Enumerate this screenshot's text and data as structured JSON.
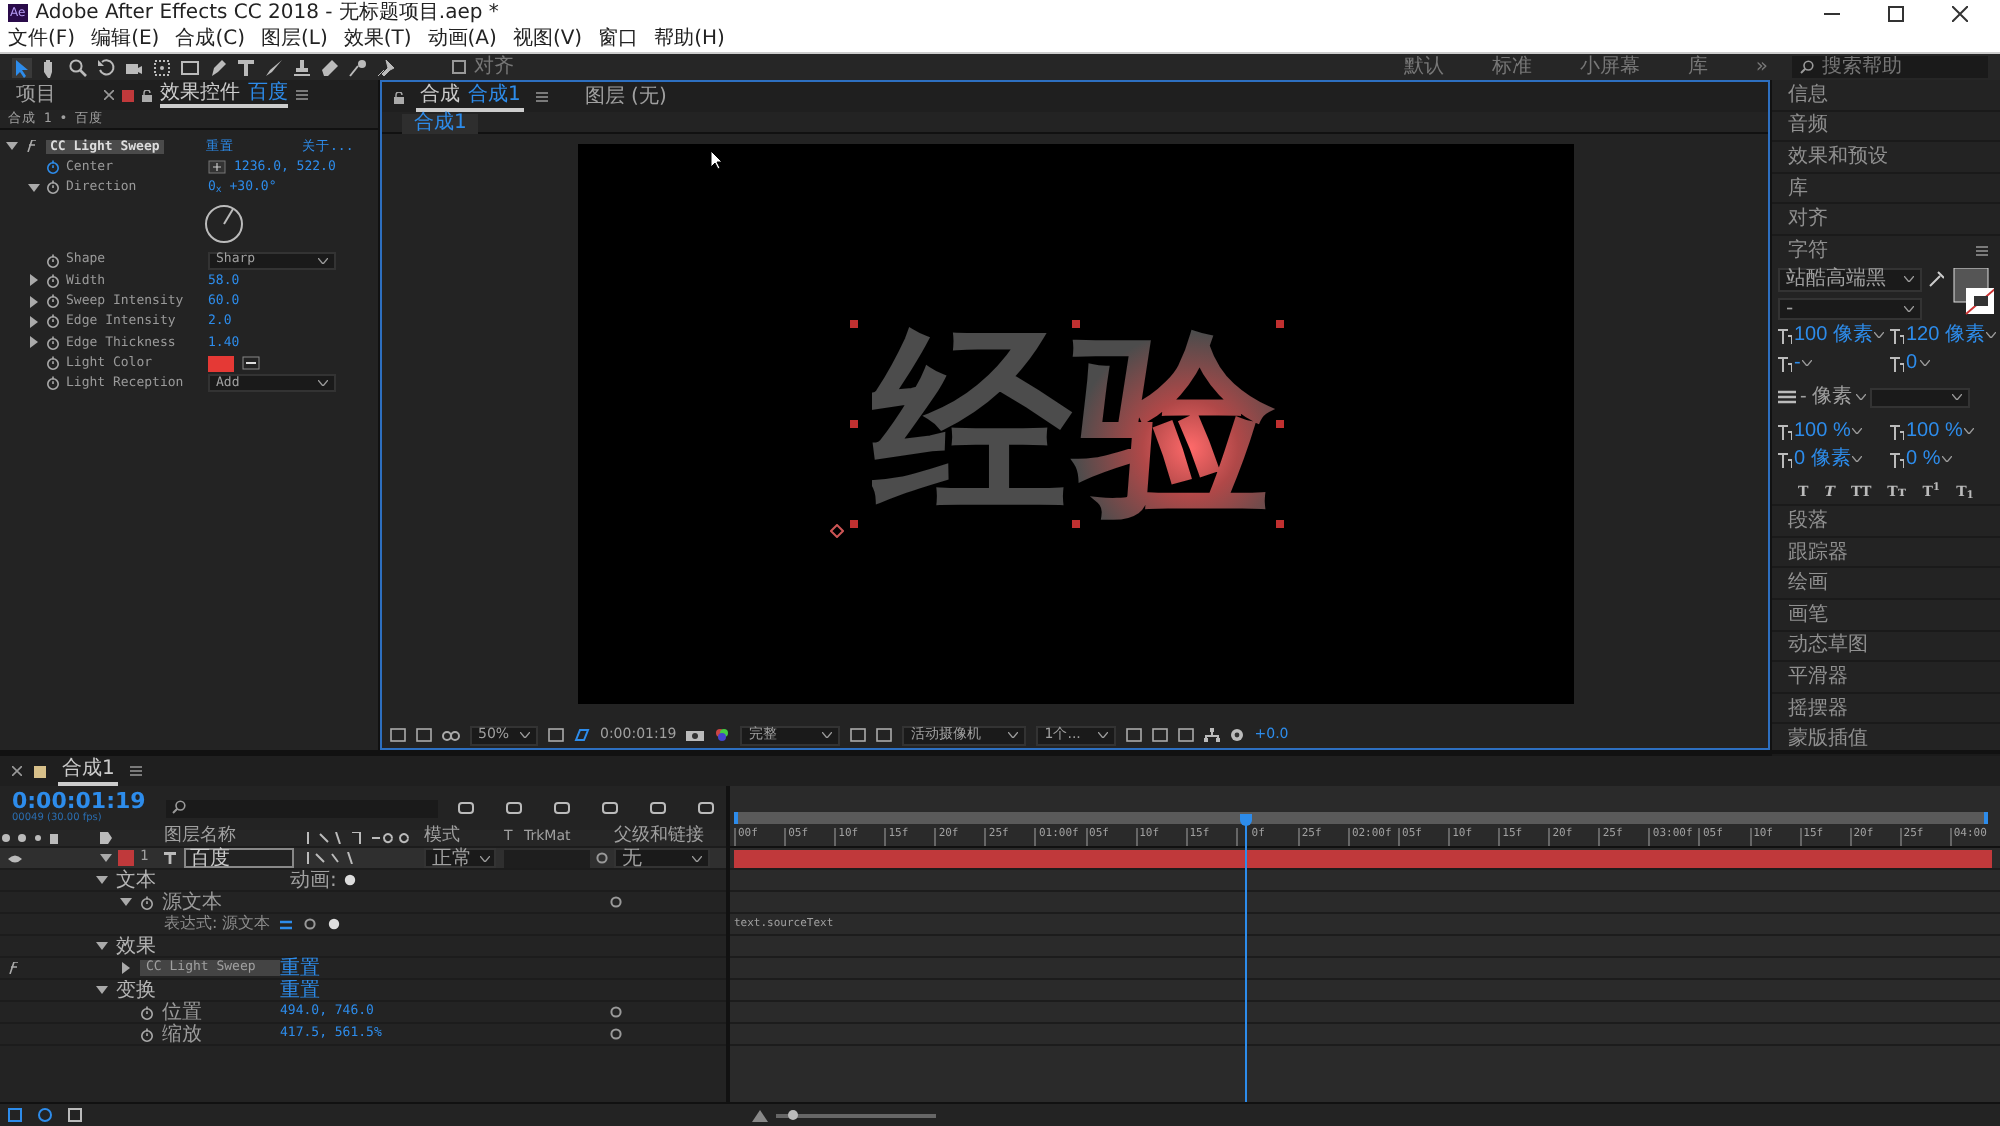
{
  "window": {
    "logo": "Ae",
    "title": "Adobe After Effects CC 2018 - 无标题项目.aep *"
  },
  "menu": [
    "文件(F)",
    "编辑(E)",
    "合成(C)",
    "图层(L)",
    "效果(T)",
    "动画(A)",
    "视图(V)",
    "窗口",
    "帮助(H)"
  ],
  "toolbar": {
    "tools": [
      {
        "kind": "select",
        "selected": true
      },
      {
        "kind": "hand",
        "selected": false
      },
      {
        "kind": "zoom",
        "selected": false
      },
      {
        "kind": "rotate",
        "selected": false
      },
      {
        "kind": "camera",
        "selected": false
      },
      {
        "kind": "pan",
        "selected": false
      },
      {
        "kind": "rect",
        "selected": false
      },
      {
        "kind": "pen",
        "selected": false
      },
      {
        "kind": "type",
        "selected": false
      },
      {
        "kind": "brush",
        "selected": false
      },
      {
        "kind": "stamp",
        "selected": false
      },
      {
        "kind": "eraser",
        "selected": false
      },
      {
        "kind": "roto",
        "selected": false
      },
      {
        "kind": "pin",
        "selected": false
      }
    ],
    "snap": {
      "label": "对齐",
      "checked": false
    },
    "workspaces": [
      "默认",
      "标准",
      "小屏幕",
      "库"
    ],
    "more": "»",
    "search": {
      "placeholder": "搜索帮助"
    }
  },
  "effect_panel": {
    "tabs": [
      {
        "label": "项目",
        "selected": false
      },
      {
        "label": "效果控件",
        "layer": "百度",
        "selected": true
      }
    ],
    "breadcrumb": "合成 1 • 百度",
    "effect": {
      "name": "CC Light Sweep",
      "reset": "重置",
      "about": "关于...",
      "expanded": true
    },
    "params": [
      {
        "kind": "point",
        "name": "Center",
        "value": "1236.0, 522.0"
      },
      {
        "kind": "angle",
        "name": "Direction",
        "value": "0$_{x}$ +30.0°",
        "expanded": true
      },
      {
        "kind": "dropdown",
        "name": "Shape",
        "value": "Sharp"
      },
      {
        "kind": "number",
        "name": "Width",
        "value": "58.0",
        "expanded": false
      },
      {
        "kind": "number",
        "name": "Sweep Intensity",
        "value": "60.0",
        "expanded": false
      },
      {
        "kind": "number",
        "name": "Edge Intensity",
        "value": "2.0",
        "expanded": false
      },
      {
        "kind": "number",
        "name": "Edge Thickness",
        "value": "1.40",
        "expanded": false
      },
      {
        "kind": "color",
        "name": "Light Color",
        "color": "#e53935"
      },
      {
        "kind": "dropdown",
        "name": "Light Reception",
        "value": "Add"
      }
    ]
  },
  "viewer": {
    "tabs": [
      {
        "label": "合成",
        "comp": "合成1",
        "selected": true
      },
      {
        "label": "图层 (无)",
        "selected": false
      }
    ],
    "sub_tab": "合成1",
    "comp_text": "经验",
    "toolbar": {
      "zoom": "50%",
      "time": "0:00:01:19",
      "resolution": "完整",
      "camera": "活动摄像机",
      "views": "1个...",
      "exposure": "+0.0"
    }
  },
  "side_panels_top": [
    "信息",
    "音频",
    "效果和预设",
    "库",
    "对齐"
  ],
  "character": {
    "title": "字符",
    "font": "站酷高端黑",
    "style": "-",
    "size": "100 像素",
    "leading": "120 像素",
    "kerning": "-",
    "tracking": "0",
    "stroke": "- 像素",
    "vscale": "100 %",
    "hscale": "100 %",
    "baseline": "0 像素",
    "tsume": "0 %",
    "styles": [
      "T",
      "T",
      "TT",
      "Tт",
      "T$^{1}$",
      "T$_{1}$"
    ]
  },
  "side_panels_bottom": [
    "段落",
    "跟踪器",
    "绘画",
    "画笔",
    "动态草图",
    "平滑器",
    "摇摆器",
    "蒙版插值"
  ],
  "timeline": {
    "tab": "合成1",
    "time": "0:00:01:19",
    "frames": "00049 (30.00 fps)",
    "columns": {
      "name": "图层名称",
      "mode": "模式",
      "t": "T",
      "trkmat": "TrkMat",
      "parent": "父级和链接"
    },
    "layers": [
      {
        "number": "1",
        "name": "百度",
        "mode": "正常",
        "parent": "无",
        "color": "#c0393b",
        "expanded": true,
        "children": [
          {
            "kind": "group",
            "label": "文本",
            "expanded": true,
            "animate": "动画:",
            "children": [
              {
                "kind": "property",
                "label": "源文本",
                "expanded": true,
                "children": [
                  {
                    "kind": "expression",
                    "label": "表达式: 源文本",
                    "expression": "text.sourceText"
                  }
                ]
              }
            ]
          },
          {
            "kind": "group",
            "label": "效果",
            "expanded": true,
            "children": [
              {
                "kind": "effect",
                "label": "CC Light Sweep",
                "expanded": false,
                "value": "重置"
              }
            ]
          },
          {
            "kind": "group",
            "label": "变换",
            "expanded": true,
            "value": "重置",
            "children": [
              {
                "kind": "property",
                "label": "位置",
                "value": "494.0, 746.0"
              },
              {
                "kind": "property",
                "label": "缩放",
                "value": "417.5, 561.5%"
              }
            ]
          }
        ]
      }
    ],
    "ruler": [
      "00f",
      "05f",
      "10f",
      "15f",
      "20f",
      "25f",
      "01:00f",
      "05f",
      "10f",
      "15f",
      "0f",
      "25f",
      "02:00f",
      "05f",
      "10f",
      "15f",
      "20f",
      "25f",
      "03:00f",
      "05f",
      "10f",
      "15f",
      "20f",
      "25f",
      "04:00"
    ],
    "zoom_slider": {
      "level": 0.1
    }
  }
}
